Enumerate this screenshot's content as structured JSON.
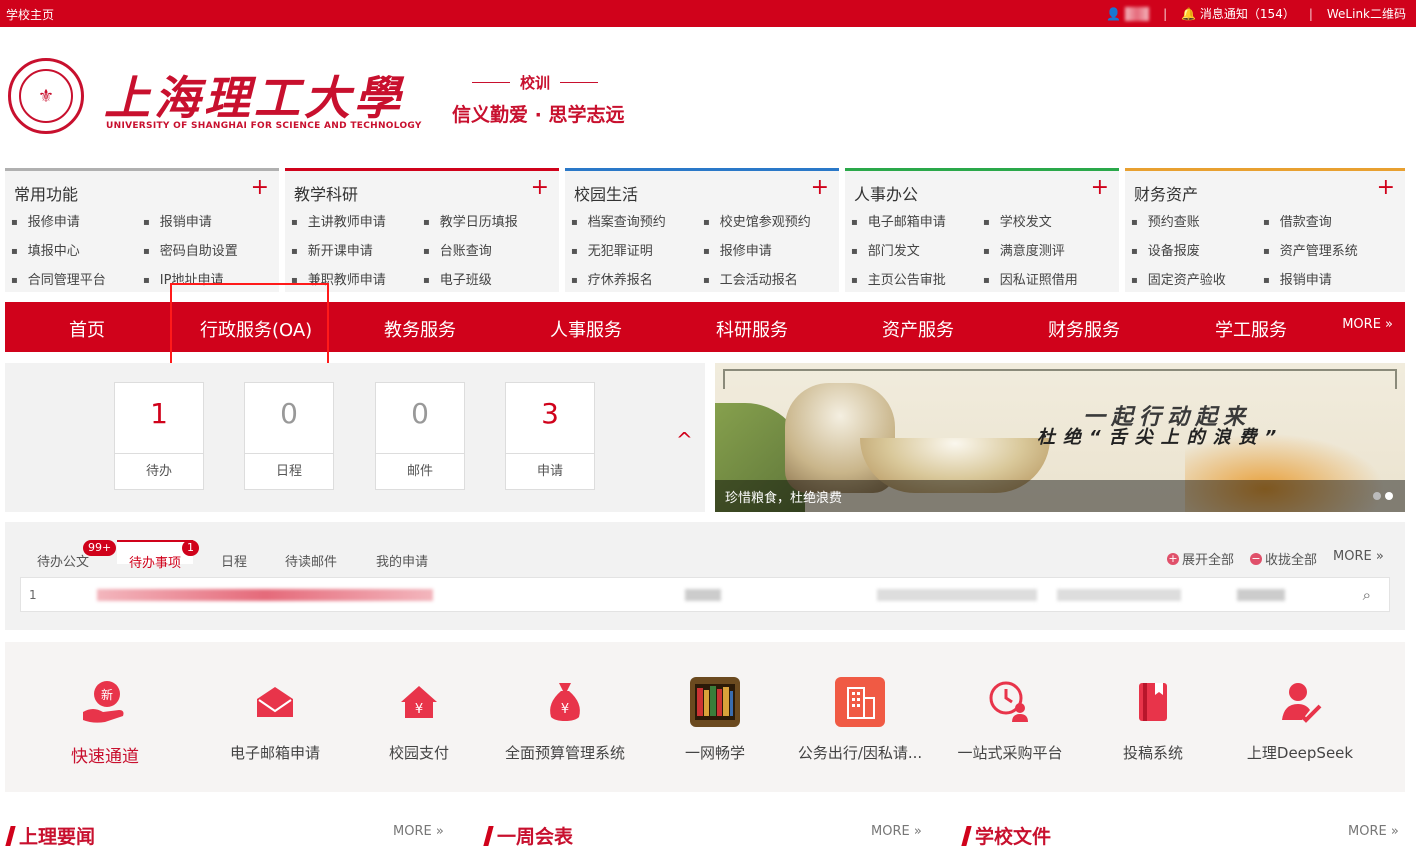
{
  "topbar": {
    "home": "学校主页",
    "messages": "消息通知（154）",
    "welink": "WeLink二维码"
  },
  "header": {
    "school_name_cn": "上海理工大學",
    "school_name_en": "UNIVERSITY OF SHANGHAI FOR SCIENCE AND TECHNOLOGY",
    "motto_title": "校训",
    "motto": "信义勤爱 · 思学志远"
  },
  "panels": [
    {
      "title": "常用功能",
      "color": "#b0b0b0",
      "items": [
        "报修申请",
        "报销申请",
        "填报中心",
        "密码自助设置",
        "合同管理平台",
        "IP地址申请"
      ]
    },
    {
      "title": "教学科研",
      "color": "#d0021b",
      "items": [
        "主讲教师申请",
        "教学日历填报",
        "新开课申请",
        "台账查询",
        "兼职教师申请",
        "电子班级"
      ]
    },
    {
      "title": "校园生活",
      "color": "#2a78c8",
      "items": [
        "档案查询预约",
        "校史馆参观预约",
        "无犯罪证明",
        "报修申请",
        "疗休养报名",
        "工会活动报名"
      ]
    },
    {
      "title": "人事办公",
      "color": "#2aa84a",
      "items": [
        "电子邮箱申请",
        "学校发文",
        "部门发文",
        "满意度测评",
        "主页公告审批",
        "因私证照借用"
      ]
    },
    {
      "title": "财务资产",
      "color": "#e8a030",
      "items": [
        "预约查账",
        "借款查询",
        "设备报废",
        "资产管理系统",
        "固定资产验收",
        "报销申请"
      ]
    }
  ],
  "nav": {
    "items": [
      "首页",
      "行政服务(OA)",
      "教务服务",
      "人事服务",
      "科研服务",
      "资产服务",
      "财务服务",
      "学工服务"
    ],
    "more": "MORE »"
  },
  "stats": [
    {
      "value": "1",
      "label": "待办",
      "color": "#d0021b"
    },
    {
      "value": "0",
      "label": "日程",
      "color": "#999999"
    },
    {
      "value": "0",
      "label": "邮件",
      "color": "#999999"
    },
    {
      "value": "3",
      "label": "申请",
      "color": "#d0021b"
    }
  ],
  "banner": {
    "line1": "一起行动起来",
    "line2": "杜绝“舌尖上的浪费”",
    "caption": "珍惜粮食，杜绝浪费"
  },
  "tasks": {
    "tabs": [
      "待办公文",
      "待办事项",
      "日程",
      "待读邮件",
      "我的申请"
    ],
    "badge_docs": "99+",
    "badge_items": "1",
    "expand_all": "展开全部",
    "collapse_all": "收拢全部",
    "more": "MORE »",
    "row_index": "1"
  },
  "quick": [
    {
      "label": "快速通道",
      "icon": "new-hand-icon"
    },
    {
      "label": "电子邮箱申请",
      "icon": "mail-icon"
    },
    {
      "label": "校园支付",
      "icon": "payment-house-icon"
    },
    {
      "label": "全面预算管理系统",
      "icon": "money-bag-icon"
    },
    {
      "label": "一网畅学",
      "icon": "bookshelf-icon"
    },
    {
      "label": "公务出行/因私请...",
      "icon": "building-icon"
    },
    {
      "label": "一站式采购平台",
      "icon": "clock-user-icon"
    },
    {
      "label": "投稿系统",
      "icon": "book-icon"
    },
    {
      "label": "上理DeepSeek",
      "icon": "user-check-icon"
    }
  ],
  "sections": [
    {
      "title": "上理要闻",
      "more": "MORE »"
    },
    {
      "title": "一周会表",
      "more": "MORE »"
    },
    {
      "title": "学校文件",
      "more": "MORE »"
    }
  ]
}
